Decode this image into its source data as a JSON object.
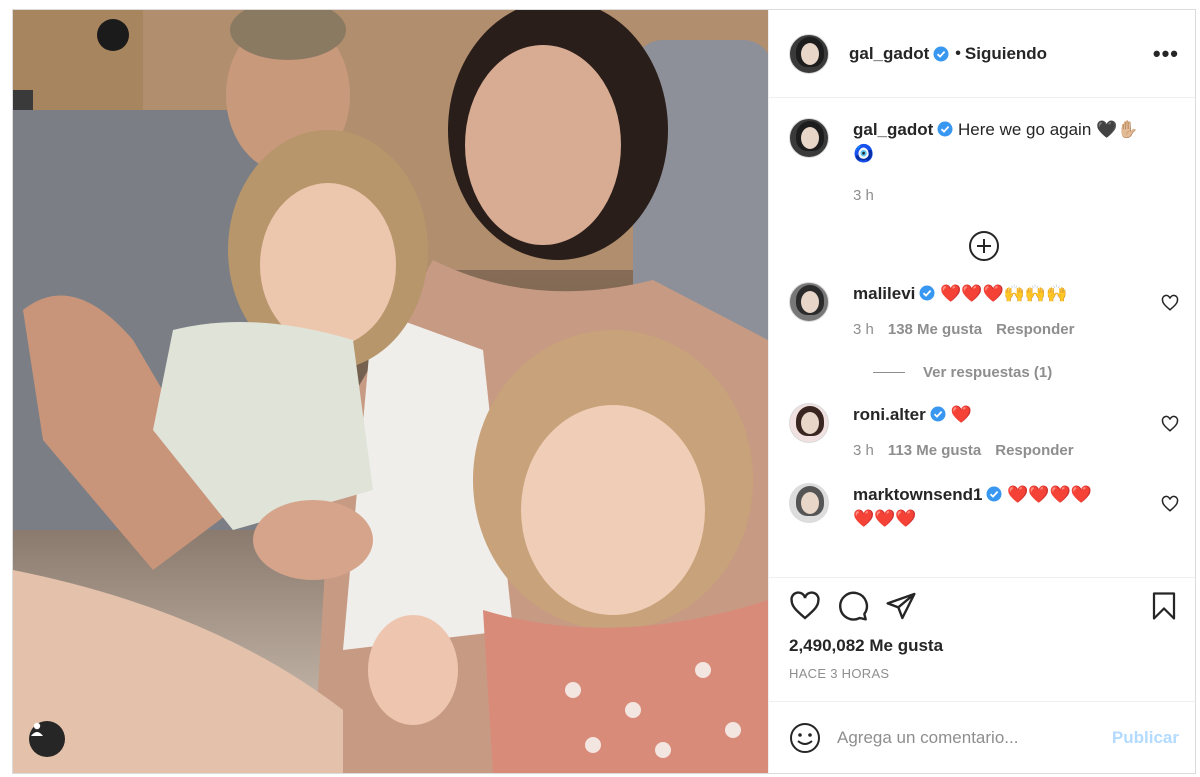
{
  "post": {
    "username": "gal_gadot",
    "separator": "•",
    "follow_status": "Siguiendo",
    "more_label": "•••",
    "caption_text": "Here we go again",
    "caption_emoji": "🖤✋🏼",
    "caption_emoji2": "🧿",
    "caption_time": "3 h",
    "likes": "2,490,082 Me gusta",
    "posted": "HACE 3 HORAS"
  },
  "comments": [
    {
      "username": "malilevi",
      "text": "❤️❤️❤️🙌🙌🙌",
      "time": "3 h",
      "likes": "138 Me gusta",
      "reply": "Responder",
      "view_replies": "Ver respuestas (1)"
    },
    {
      "username": "roni.alter",
      "text": "❤️",
      "time": "3 h",
      "likes": "113 Me gusta",
      "reply": "Responder"
    },
    {
      "username": "marktownsend1",
      "text": "❤️❤️❤️❤️",
      "text2": "❤️❤️❤️"
    }
  ],
  "composer": {
    "placeholder": "Agrega un comentario...",
    "publish": "Publicar"
  },
  "colors": {
    "verified": "#3897f0",
    "publish_disabled": "#b3dbff",
    "muted": "#8e8e8e"
  },
  "icons": [
    "heart-icon",
    "comment-icon",
    "share-icon",
    "bookmark-icon",
    "add-circle-icon",
    "emoji-icon",
    "user-tag-icon",
    "more-icon",
    "verified-icon"
  ]
}
